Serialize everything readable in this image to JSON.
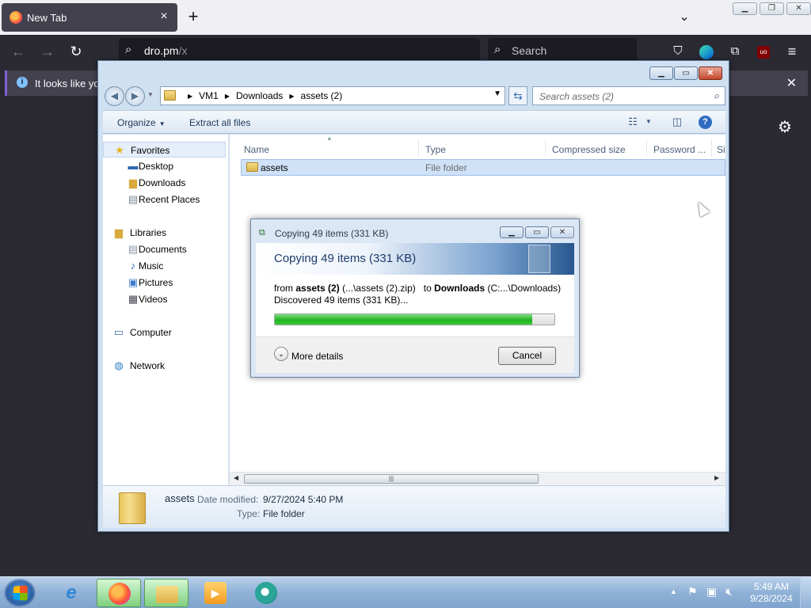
{
  "firefox": {
    "tab_title": "New Tab",
    "url_host": "dro.pm",
    "url_path": "/x",
    "search_placeholder": "Search",
    "notification": "It looks like yo"
  },
  "explorer": {
    "breadcrumbs": [
      "VM1",
      "Downloads",
      "assets (2)"
    ],
    "search_placeholder": "Search assets (2)",
    "toolbar": {
      "organize": "Organize",
      "extract_all": "Extract all files"
    },
    "nav": {
      "favorites": "Favorites",
      "favorites_items": [
        "Desktop",
        "Downloads",
        "Recent Places"
      ],
      "libraries": "Libraries",
      "library_items": [
        "Documents",
        "Music",
        "Pictures",
        "Videos"
      ],
      "computer": "Computer",
      "network": "Network"
    },
    "columns": [
      "Name",
      "Type",
      "Compressed size",
      "Password ...",
      "Si"
    ],
    "rows": [
      {
        "name": "assets",
        "type": "File folder"
      }
    ],
    "details": {
      "name": "assets",
      "modified_label": "Date modified:",
      "modified_value": "9/27/2024 5:40 PM",
      "type_label": "Type:",
      "type_value": "File folder"
    }
  },
  "copy_dialog": {
    "title": "Copying 49 items (331 KB)",
    "heading": "Copying 49 items (331 KB)",
    "from_label": "from",
    "from_name": "assets (2)",
    "from_path": "(...\\assets (2).zip)",
    "to_label": "to",
    "to_name": "Downloads",
    "to_path": "(C:...\\Downloads)",
    "status": "Discovered 49 items (331 KB)...",
    "progress": 0.92,
    "more_details": "More details",
    "cancel": "Cancel"
  },
  "taskbar": {
    "time": "5:49 AM",
    "date": "9/28/2024"
  },
  "colors": {
    "progress_green": "#22b322",
    "firefox_dark": "#2b2a33",
    "taskbar_blue": "#8fb1d6"
  }
}
